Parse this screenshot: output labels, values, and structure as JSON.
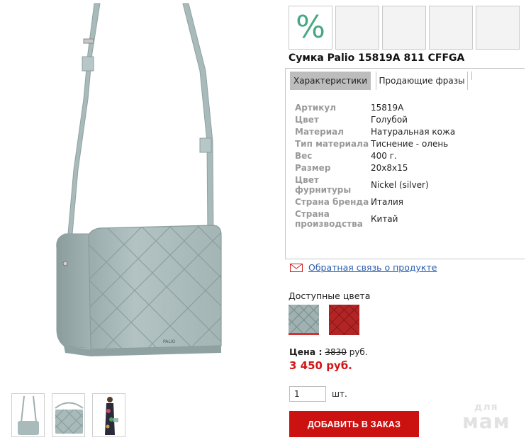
{
  "product": {
    "title": "Сумка Palio 15819A 811 CFFGA",
    "sale_badge": "%"
  },
  "tabs": [
    {
      "label": "Характеристики",
      "active": true
    },
    {
      "label": "Продающие фразы",
      "active": false
    }
  ],
  "specs": [
    {
      "label": "Артикул",
      "value": "15819A"
    },
    {
      "label": "Цвет",
      "value": "Голубой"
    },
    {
      "label": "Материал",
      "value": "Натуральная кожа"
    },
    {
      "label": "Тип материала",
      "value": "Тиснение - олень"
    },
    {
      "label": "Вес",
      "value": "400 г."
    },
    {
      "label": "Размер",
      "value": "20x8x15"
    },
    {
      "label": "Цвет фурнитуры",
      "value": "Nickel (silver)"
    },
    {
      "label": "Страна бренда",
      "value": "Италия"
    },
    {
      "label": "Страна производства",
      "value": "Китай"
    }
  ],
  "feedback": {
    "link": "Обратная связь о продукте",
    "icon": "envelope-icon"
  },
  "colors": {
    "label": "Доступные цвета",
    "swatches": [
      {
        "color": "#9fb1b1",
        "selected": true
      },
      {
        "color": "#b32525",
        "selected": false
      }
    ]
  },
  "price": {
    "label": "Цена :",
    "old": "3830",
    "currency": "руб.",
    "new": "3 450 руб."
  },
  "quantity": {
    "value": "1",
    "unit": "шт."
  },
  "order_button": "ДОБАВИТЬ В ЗАКАЗ",
  "bag_brand_text": "PALIO",
  "watermark": {
    "top": "для",
    "bottom": "мам"
  },
  "colors_palette": {
    "accent": "#cc1111",
    "link": "#2a5cad",
    "sale_icon": "#46a884",
    "bag": "#a9b9b9"
  }
}
